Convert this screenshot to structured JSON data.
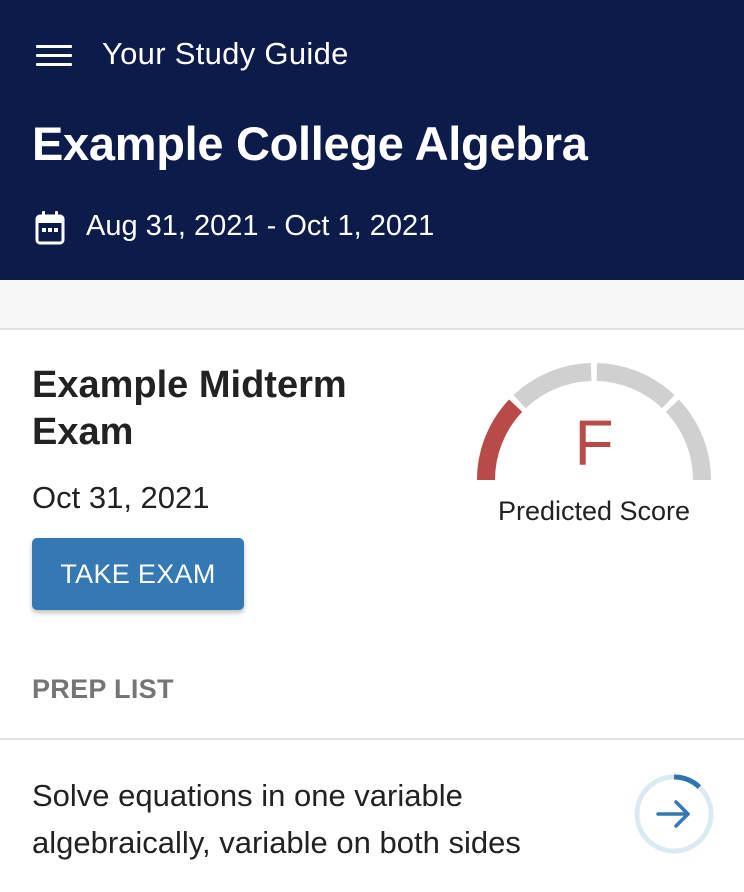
{
  "header": {
    "app_title": "Your Study Guide",
    "course_title": "Example College Algebra",
    "date_range": "Aug 31, 2021 - Oct 1, 2021"
  },
  "exam": {
    "title": "Example Midterm Exam",
    "date": "Oct 31, 2021",
    "take_button_label": "TAKE EXAM",
    "predicted_score": {
      "letter": "F",
      "label": "Predicted Score",
      "filled_segments": 1,
      "total_segments": 4
    }
  },
  "prep_list": {
    "heading": "PREP LIST",
    "items": [
      {
        "text": "Solve equations in one variable algebraically, variable on both sides",
        "progress": 0.12
      }
    ]
  },
  "colors": {
    "header_bg": "#0c1b4a",
    "primary_button": "#3478b4",
    "score_fail": "#b94a4a",
    "gauge_inactive": "#d0d0d0",
    "progress_ring": "#2f72ac",
    "progress_track": "#dbeaf1"
  },
  "icons": {
    "menu": "hamburger-menu-icon",
    "calendar": "calendar-icon",
    "arrow": "arrow-right-icon"
  }
}
